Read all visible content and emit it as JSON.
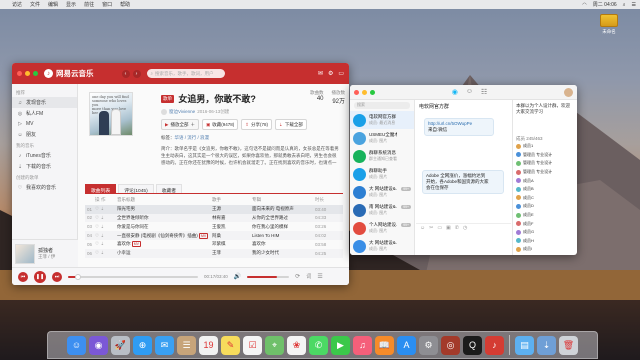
{
  "menubar": {
    "items": [
      "访达",
      "文件",
      "编辑",
      "显示",
      "前往",
      "窗口",
      "帮助"
    ],
    "clock": "周二 04:06"
  },
  "desktop": {
    "disk_label": "未命名"
  },
  "music": {
    "app_name": "网易云音乐",
    "search_placeholder": "搜索音乐，歌手，歌词，用户",
    "sidebar": {
      "sections": [
        {
          "header": "推荐",
          "items": [
            {
              "icon": "music-note-icon",
              "label": "发现音乐"
            },
            {
              "icon": "radio-icon",
              "label": "私人FM"
            },
            {
              "icon": "video-icon",
              "label": "MV"
            },
            {
              "icon": "friends-icon",
              "label": "朋友"
            }
          ]
        },
        {
          "header": "我的音乐",
          "items": [
            {
              "icon": "itunes-icon",
              "label": "iTunes音乐"
            },
            {
              "icon": "download-icon",
              "label": "下载的音乐"
            }
          ]
        },
        {
          "header": "创建的歌单",
          "items": [
            {
              "icon": "heart-icon",
              "label": "我喜欢的音乐"
            }
          ]
        }
      ]
    },
    "mini_player": {
      "title": "孤独者",
      "artist": "王菲 / 伊"
    },
    "playlist": {
      "tag": "歌单",
      "title": "女追男，你敢不敢?",
      "author": "窗边Vivienne",
      "date": "2016-06-13创建",
      "stats": [
        {
          "label": "歌曲数",
          "value": "40"
        },
        {
          "label": "播放数",
          "value": "92万"
        }
      ],
      "buttons": {
        "play_all": "播放全部",
        "collect": "收藏(9478)",
        "share": "分享(78)",
        "download": "下载全部"
      },
      "tags_label": "标签：",
      "tags": "华语 / 流行 / 浪漫",
      "description": "简介：歌单名字是《女追男，你敢不敢》，这句话不是疑问而是认真的，女孩总是在等着男生主动表白，这其实是一个很大的误区，如果你喜欢他，那就勇敢去表白吧，男生也会很感动的。正在你还在犹豫的时候，也许机会就溜走了。正在找到喜欢的音乐时，也请点一点收藏吧。"
    },
    "cover_text": "one day you will find\nsomeone who loves you\nmore than you love her",
    "tabs": [
      "歌曲列表",
      "评论(1045)",
      "收藏者"
    ],
    "table": {
      "headers": [
        "操作",
        "音乐标题",
        "歌手",
        "专辑",
        "时长"
      ],
      "rows": [
        {
          "num": "01",
          "title": "阳光宅男",
          "mv": "",
          "artist": "王源",
          "album": "面向未来的 电视原声",
          "duration": "03:40"
        },
        {
          "num": "02",
          "title": "全世界谁倾听你",
          "mv": "",
          "artist": "林宥嘉",
          "album": "从你的全世界路过",
          "duration": "04:33"
        },
        {
          "num": "03",
          "title": "你爱是与你同在",
          "mv": "",
          "artist": "王俊凯",
          "album": "你在我心里的模样",
          "duration": "03:26"
        },
        {
          "num": "04",
          "title": "一直很安静 (电视剧《仙剑奇侠传》插曲)",
          "mv": "MV",
          "artist": "阿桑",
          "album": "Listen To HIM",
          "duration": "04:02"
        },
        {
          "num": "05",
          "title": "喜欢你",
          "mv": "MV",
          "artist": "邓紫棋",
          "album": "喜欢你",
          "duration": "03:58"
        },
        {
          "num": "06",
          "title": "小幸运",
          "mv": "",
          "artist": "王菲",
          "album": "我的少女时代",
          "duration": "04:25"
        }
      ]
    },
    "player": {
      "time": "00:17/03:40",
      "progress": 0.08,
      "volume": 0.7
    }
  },
  "qq": {
    "search_placeholder": "搜索",
    "contacts": [
      {
        "title": "电软网官方群",
        "sub": "成员: 最近消息",
        "time": "",
        "badge": "",
        "color": "#1aa0e8"
      },
      {
        "title": "USMEU全魔术师...",
        "sub": "成员: 图片",
        "time": "",
        "badge": "",
        "color": "#4aa3df"
      },
      {
        "title": "群聊系统消息",
        "sub": "群主通知已查看...",
        "time": "",
        "badge": "",
        "color": "#18b35c"
      },
      {
        "title": "群聊助手",
        "sub": "成员: 图片",
        "time": "",
        "badge": "",
        "color": "#1aa0e8"
      },
      {
        "title": "大 网站建设&...",
        "sub": "成员: 图片",
        "time": "",
        "badge": "99+",
        "color": "#2d7fd3"
      },
      {
        "title": "南 网站建设&...",
        "sub": "成员: 图片",
        "time": "",
        "badge": "99+",
        "color": "#2a6bb5"
      },
      {
        "title": "个人网站建设...",
        "sub": "成员: 图片",
        "time": "",
        "badge": "99+",
        "color": "#e24c3f"
      },
      {
        "title": "大 网站建设&...",
        "sub": "成员: 图片",
        "time": "",
        "badge": "",
        "color": "#3a8ee6"
      }
    ],
    "chat": {
      "title": "电软网官方群",
      "messages": [
        {
          "lines": [
            "http://url.cn/5OWupPe",
            "来自:微信"
          ]
        },
        {
          "lines": [
            "Adobe 全网涨价，涨幅约达到",
            "开始，各Adobe和国资源的大家",
            "会在位保存"
          ]
        }
      ]
    },
    "notice": "本群以为个人设计群，欢迎大家交流学习",
    "member_header": "成员 245/463",
    "members": [
      "成员1",
      "管理员 专业设计",
      "管理员 专业设计",
      "管理员 专业设计",
      "成员A",
      "成员B",
      "成员C",
      "成员D",
      "成员E",
      "成员F",
      "成员G",
      "成员H",
      "成员I",
      "成员J"
    ]
  },
  "dock": {
    "apps": [
      {
        "name": "finder-icon",
        "glyph": "☺",
        "color": "#3d8ff0"
      },
      {
        "name": "siri-icon",
        "glyph": "◉",
        "color": "#7b58d6"
      },
      {
        "name": "launchpad-icon",
        "glyph": "🚀",
        "color": "#b9bec6"
      },
      {
        "name": "safari-icon",
        "glyph": "⊕",
        "color": "#2f9cf3"
      },
      {
        "name": "mail-icon",
        "glyph": "✉",
        "color": "#3aa0f2"
      },
      {
        "name": "contacts-icon",
        "glyph": "☰",
        "color": "#c7a47a"
      },
      {
        "name": "calendar-icon",
        "glyph": "19",
        "color": "#f2f2f2"
      },
      {
        "name": "notes-icon",
        "glyph": "✎",
        "color": "#f7dc5c"
      },
      {
        "name": "reminders-icon",
        "glyph": "☑",
        "color": "#f5f5f5"
      },
      {
        "name": "maps-icon",
        "glyph": "⌖",
        "color": "#6fc06a"
      },
      {
        "name": "photos-icon",
        "glyph": "❀",
        "color": "#f4f4f4"
      },
      {
        "name": "messages-icon",
        "glyph": "✆",
        "color": "#4cd964"
      },
      {
        "name": "facetime-icon",
        "glyph": "▶",
        "color": "#3bc84a"
      },
      {
        "name": "music-icon",
        "glyph": "♫",
        "color": "#f55f7a"
      },
      {
        "name": "books-icon",
        "glyph": "📖",
        "color": "#f58b2a"
      },
      {
        "name": "appstore-icon",
        "glyph": "A",
        "color": "#2b8ef1"
      },
      {
        "name": "settings-icon",
        "glyph": "⚙",
        "color": "#8e8e93"
      },
      {
        "name": "photobooth-icon",
        "glyph": "◎",
        "color": "#a33a2a"
      },
      {
        "name": "qq-icon",
        "glyph": "Q",
        "color": "#1b1b1b"
      },
      {
        "name": "netease-music-icon",
        "glyph": "♪",
        "color": "#d43c33"
      },
      {
        "name": "folder-icon",
        "glyph": "▤",
        "color": "#5db0f0"
      },
      {
        "name": "downloads-icon",
        "glyph": "⇣",
        "color": "#6f9fd6"
      },
      {
        "name": "trash-icon",
        "glyph": "🗑",
        "color": "#cfd3d8"
      }
    ]
  }
}
